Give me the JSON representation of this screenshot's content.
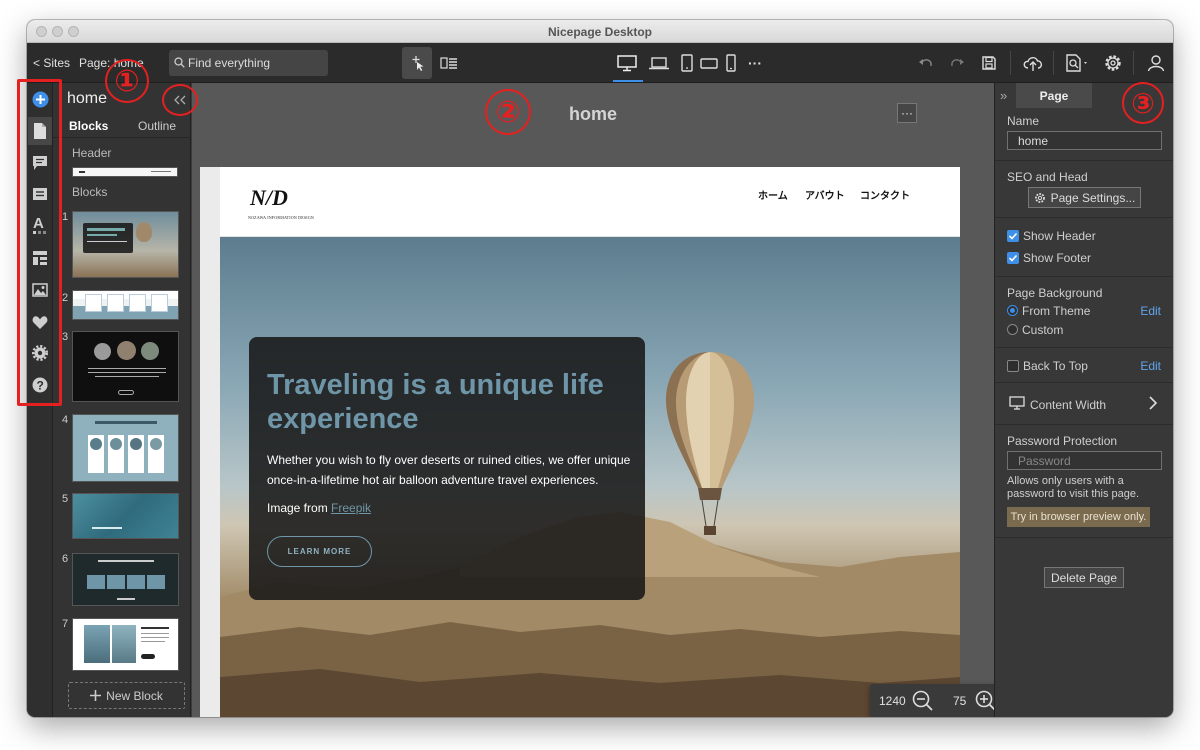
{
  "window": {
    "title": "Nicepage Desktop"
  },
  "toolbar": {
    "sites_link": "< Sites",
    "page_label": "Page: home",
    "search_placeholder": "Find everything",
    "more_label": "···"
  },
  "left_sidebar": {
    "icons": [
      "add-icon",
      "page-icon",
      "comment-icon",
      "block-icon",
      "text-style-icon",
      "layout-icon",
      "image-icon",
      "heart-icon",
      "settings-icon",
      "help-icon"
    ]
  },
  "left_panel": {
    "title": "home",
    "tabs": [
      "Blocks",
      "Outline"
    ],
    "header_label": "Header",
    "blocks_label": "Blocks",
    "block_numbers": [
      "1",
      "2",
      "3",
      "4",
      "5",
      "6",
      "7"
    ],
    "new_block_label": "New Block"
  },
  "canvas": {
    "page_name": "home",
    "menu_label": "···",
    "width_value": "1240",
    "zoom_value": "75"
  },
  "site": {
    "logo_mark": "N/D",
    "logo_sub": "NOZAWA INFORMATION DESIGN",
    "nav": [
      "ホーム",
      "アバウト",
      "コンタクト"
    ],
    "hero": {
      "title": "Traveling is a unique life experience",
      "text": "Whether you wish to fly over deserts or ruined cities, we offer unique once-in-a-lifetime hot air balloon adventure travel experiences.",
      "credit_prefix": "Image from ",
      "credit_link": "Freepik",
      "button": "LEARN MORE"
    }
  },
  "right_panel": {
    "collapse_label": "»",
    "tab": "Page",
    "name_label": "Name",
    "name_value": "home",
    "seo_label": "SEO and Head",
    "page_settings_button": "Page Settings...",
    "show_header_label": "Show Header",
    "show_header_checked": true,
    "show_footer_label": "Show Footer",
    "show_footer_checked": true,
    "page_background_label": "Page Background",
    "from_theme_label": "From Theme",
    "custom_label": "Custom",
    "background_selected": "From Theme",
    "edit_label": "Edit",
    "back_to_top_label": "Back To Top",
    "back_to_top_checked": false,
    "content_width_label": "Content Width",
    "password_label": "Password Protection",
    "password_placeholder": "Password",
    "password_note": "Allows only users with a password to visit this page.",
    "try_preview_label": "Try in browser preview only.",
    "delete_page_button": "Delete Page"
  },
  "annotations": {
    "one": "①",
    "two": "②",
    "three": "③"
  },
  "colors": {
    "accent": "#3d8fe8",
    "annotation_red": "#e52020",
    "hero_title": "#6f96a8",
    "link_blue": "#5fa5ee"
  }
}
